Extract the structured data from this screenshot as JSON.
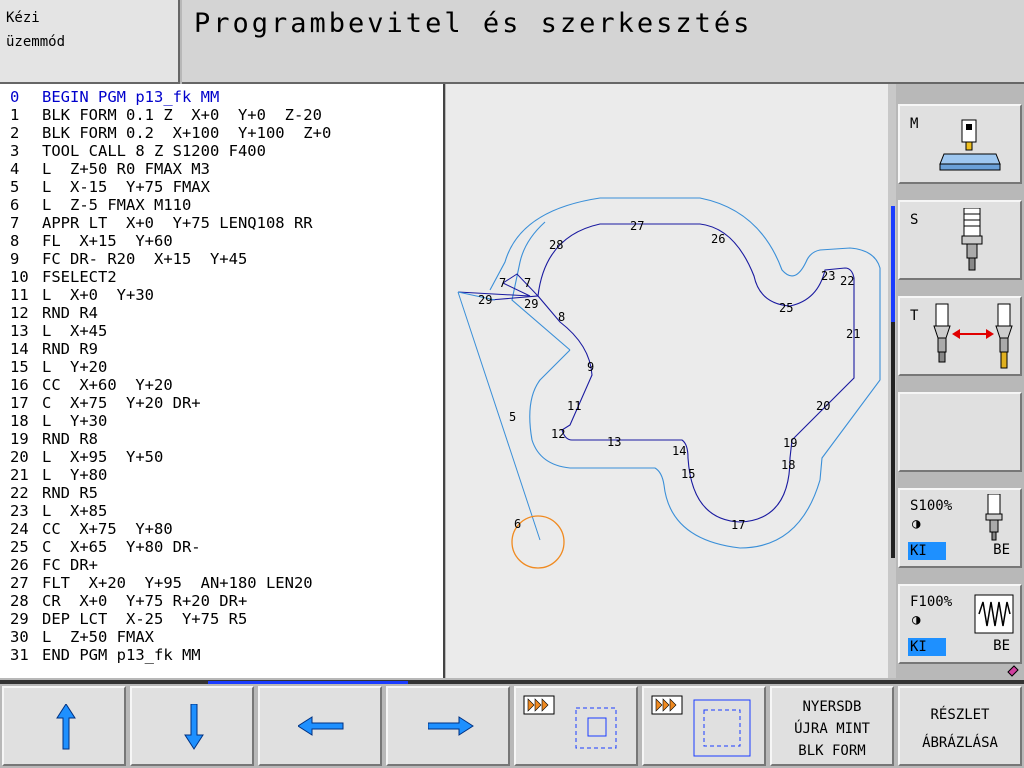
{
  "mode": {
    "line1": "Kézi",
    "line2": "üzemmód"
  },
  "title": "Programbevitel és szerkesztés",
  "program": [
    {
      "n": "0",
      "code": "BEGIN PGM p13_fk MM"
    },
    {
      "n": "1",
      "code": "BLK FORM 0.1 Z  X+0  Y+0  Z-20"
    },
    {
      "n": "2",
      "code": "BLK FORM 0.2  X+100  Y+100  Z+0"
    },
    {
      "n": "3",
      "code": "TOOL CALL 8 Z S1200 F400"
    },
    {
      "n": "4",
      "code": "L  Z+50 R0 FMAX M3"
    },
    {
      "n": "5",
      "code": "L  X-15  Y+75 FMAX"
    },
    {
      "n": "6",
      "code": "L  Z-5 FMAX M110"
    },
    {
      "n": "7",
      "code": "APPR LT  X+0  Y+75 LENQ108 RR"
    },
    {
      "n": "8",
      "code": "FL  X+15  Y+60"
    },
    {
      "n": "9",
      "code": "FC DR- R20  X+15  Y+45"
    },
    {
      "n": "10",
      "code": "FSELECT2"
    },
    {
      "n": "11",
      "code": "L  X+0  Y+30"
    },
    {
      "n": "12",
      "code": "RND R4"
    },
    {
      "n": "13",
      "code": "L  X+45"
    },
    {
      "n": "14",
      "code": "RND R9"
    },
    {
      "n": "15",
      "code": "L  Y+20"
    },
    {
      "n": "16",
      "code": "CC  X+60  Y+20"
    },
    {
      "n": "17",
      "code": "C  X+75  Y+20 DR+"
    },
    {
      "n": "18",
      "code": "L  Y+30"
    },
    {
      "n": "19",
      "code": "RND R8"
    },
    {
      "n": "20",
      "code": "L  X+95  Y+50"
    },
    {
      "n": "21",
      "code": "L  Y+80"
    },
    {
      "n": "22",
      "code": "RND R5"
    },
    {
      "n": "23",
      "code": "L  X+85"
    },
    {
      "n": "24",
      "code": "CC  X+75  Y+80"
    },
    {
      "n": "25",
      "code": "C  X+65  Y+80 DR-"
    },
    {
      "n": "26",
      "code": "FC DR+"
    },
    {
      "n": "27",
      "code": "FLT  X+20  Y+95  AN+180 LEN20"
    },
    {
      "n": "28",
      "code": "CR  X+0  Y+75 R+20 DR+"
    },
    {
      "n": "29",
      "code": "DEP LCT  X-25  Y+75 R5"
    },
    {
      "n": "30",
      "code": "L  Z+50 FMAX"
    },
    {
      "n": "31",
      "code": "END PGM p13_fk MM"
    }
  ],
  "graphic_labels": [
    "27",
    "26",
    "28",
    "7",
    "7",
    "23",
    "22",
    "29",
    "29",
    "25",
    "8",
    "21",
    "9",
    "20",
    "11",
    "12",
    "13",
    "14",
    "19",
    "18",
    "15",
    "5",
    "6",
    "17"
  ],
  "softkeys": {
    "m": "M",
    "s": "S",
    "t": "T",
    "spindle": {
      "label": "S100%",
      "off": "KI",
      "on": "BE"
    },
    "feed": {
      "label": "F100%",
      "off": "KI",
      "on": "BE"
    }
  },
  "fkeys": {
    "reset_blk_l1": "NYERSDB",
    "reset_blk_l2": "ÚJRA MINT",
    "reset_blk_l3": "BLK FORM",
    "detail_l1": "RÉSZLET",
    "detail_l2": "ÁBRÁZLÁSA"
  },
  "colors": {
    "contour": "#1a1aa0",
    "offset": "#3a8fd8",
    "tool": "#f08a20",
    "active_line": "#0000cc"
  }
}
